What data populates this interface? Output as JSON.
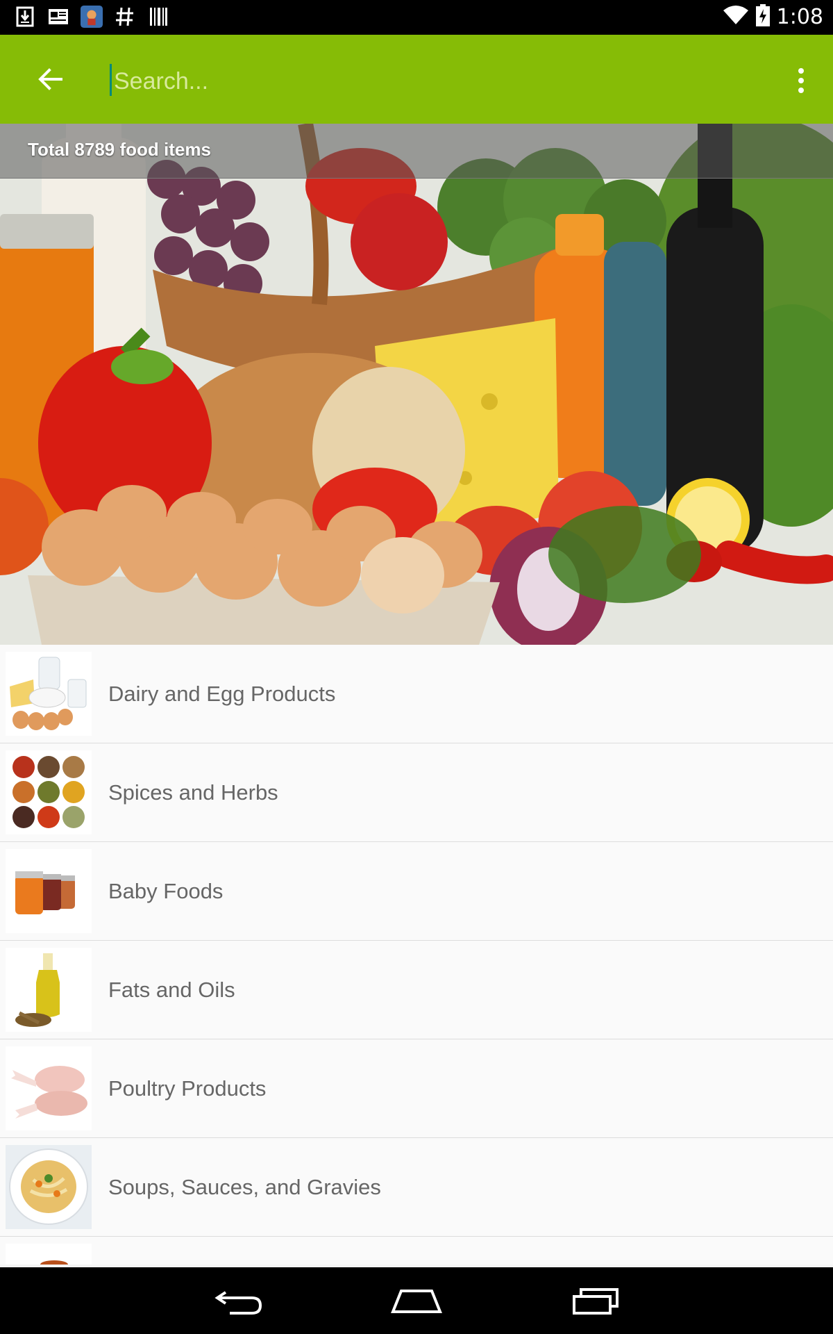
{
  "status_bar": {
    "time": "1:08",
    "icons": [
      "download-icon",
      "news-icon",
      "app-icon",
      "hash-icon",
      "barcode-icon",
      "wifi-icon",
      "battery-icon"
    ]
  },
  "toolbar": {
    "search_placeholder": "Search...",
    "search_value": "",
    "back_icon": "arrow-left-icon",
    "more_icon": "more-vert-icon",
    "color": "#86bc06"
  },
  "hero": {
    "banner_text": "Total 8789 food items"
  },
  "categories": [
    {
      "label": "Dairy and Egg Products",
      "icon": "dairy-thumb"
    },
    {
      "label": "Spices and Herbs",
      "icon": "spices-thumb"
    },
    {
      "label": "Baby Foods",
      "icon": "baby-food-thumb"
    },
    {
      "label": "Fats and Oils",
      "icon": "oil-thumb"
    },
    {
      "label": "Poultry Products",
      "icon": "poultry-thumb"
    },
    {
      "label": "Soups, Sauces, and Gravies",
      "icon": "soup-thumb"
    }
  ],
  "nav_bar": {
    "back": "nav-back-icon",
    "home": "nav-home-icon",
    "recents": "nav-recents-icon"
  }
}
